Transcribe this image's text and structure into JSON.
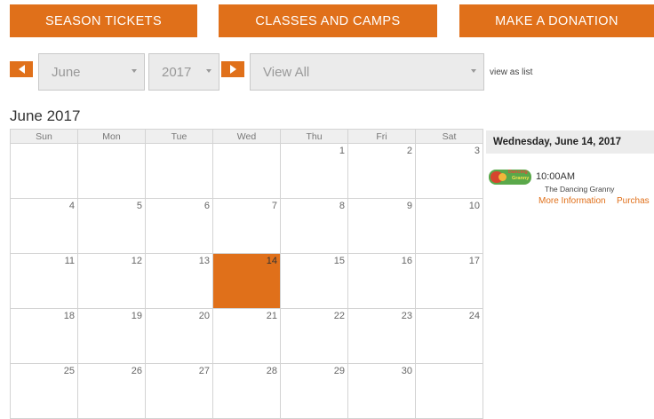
{
  "top_buttons": {
    "season": "SEASON TICKETS",
    "classes": "CLASSES AND CAMPS",
    "donate": "MAKE A DONATION"
  },
  "nav": {
    "month": "June",
    "year": "2017",
    "view": "View All",
    "view_as_list": "view as list"
  },
  "calendar": {
    "title": "June 2017",
    "weekdays": [
      "Sun",
      "Mon",
      "Tue",
      "Wed",
      "Thu",
      "Fri",
      "Sat"
    ],
    "weeks": [
      [
        "",
        "",
        "",
        "",
        "1",
        "2",
        "3"
      ],
      [
        "4",
        "5",
        "6",
        "7",
        "8",
        "9",
        "10"
      ],
      [
        "11",
        "12",
        "13",
        "14",
        "15",
        "16",
        "17"
      ],
      [
        "18",
        "19",
        "20",
        "21",
        "22",
        "23",
        "24"
      ],
      [
        "25",
        "26",
        "27",
        "28",
        "29",
        "30",
        ""
      ]
    ],
    "selected_day": "14"
  },
  "panel": {
    "date_heading": "Wednesday, June 14, 2017",
    "event": {
      "time": "10:00AM",
      "name": "The Dancing Granny",
      "more_info": "More Information",
      "purchase": "Purchas",
      "thumb_text_1": "Dancing",
      "thumb_text_2": "Granny"
    }
  },
  "colors": {
    "accent": "#e0701a",
    "header_bg": "#efefef",
    "select_bg": "#ebebeb"
  }
}
